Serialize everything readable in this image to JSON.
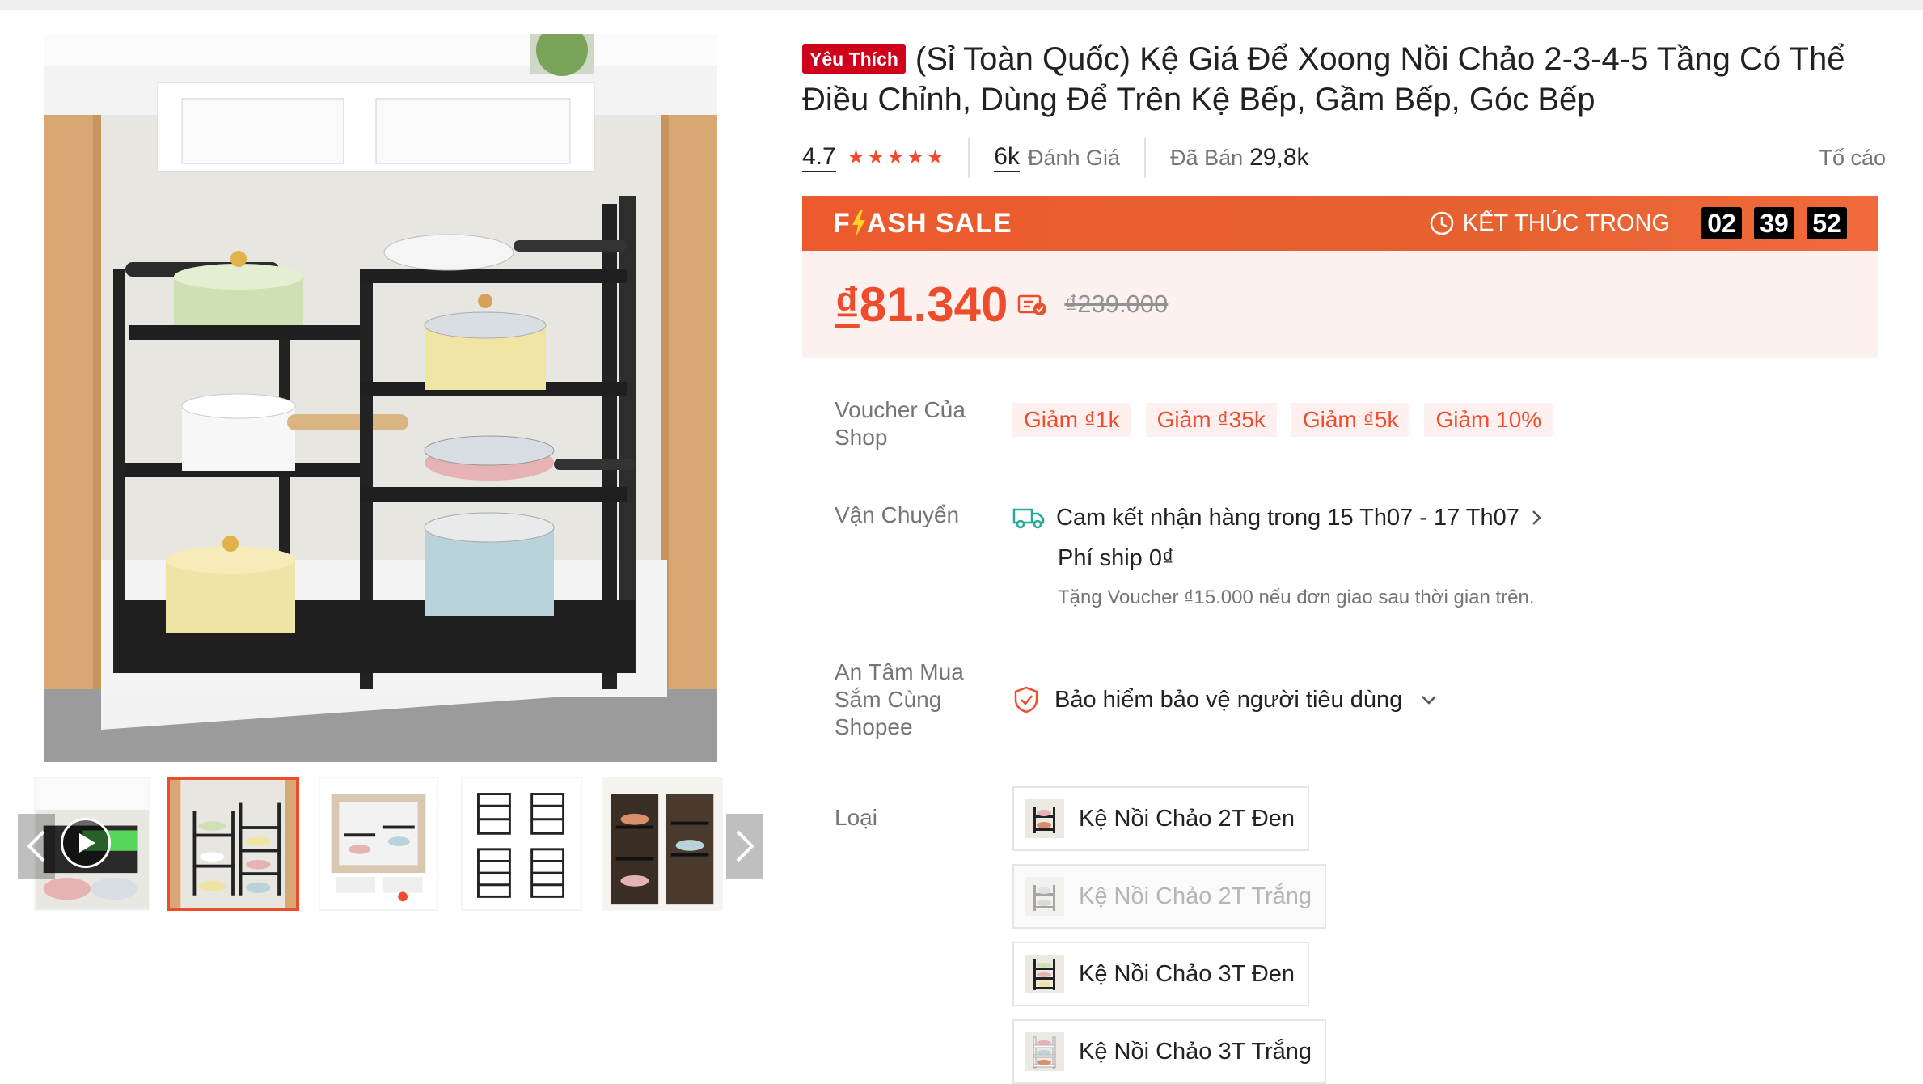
{
  "gallery": {
    "thumbnails": [
      {
        "name": "video-thumbnail",
        "has_video": true
      },
      {
        "name": "thumbnail-2",
        "active": true
      },
      {
        "name": "thumbnail-3"
      },
      {
        "name": "thumbnail-4"
      },
      {
        "name": "thumbnail-5"
      }
    ]
  },
  "product": {
    "favorite_badge": "Yêu Thích",
    "title": "(Sỉ Toàn Quốc) Kệ Giá Để Xoong Nồi Chảo 2-3-4-5 Tầng Có Thể Điều Chỉnh, Dùng Để Trên Kệ Bếp, Gầm Bếp, Góc Bếp"
  },
  "stats": {
    "rating": "4.7",
    "stars": 5,
    "reviews_count": "6k",
    "reviews_label": "Đánh Giá",
    "sold_label": "Đã Bán",
    "sold_count": "29,8k",
    "report_label": "Tố cáo"
  },
  "flash_sale": {
    "logo_pre": "F",
    "logo_post": "ASH SALE",
    "ends_label": "KẾT THÚC TRONG",
    "hours": "02",
    "minutes": "39",
    "seconds": "52"
  },
  "price": {
    "currency": "₫",
    "current": "81.340",
    "original": "₫239.000"
  },
  "shop_voucher": {
    "label": "Voucher Của Shop",
    "chips": [
      "Giảm ₫1k",
      "Giảm ₫35k",
      "Giảm ₫5k",
      "Giảm 10%"
    ]
  },
  "shipping": {
    "label": "Vận Chuyển",
    "delivery": "Cam kết nhận hàng trong 15 Th07 - 17 Th07",
    "fee": "Phí ship 0₫",
    "note": "Tặng Voucher ₫15.000 nếu đơn giao sau thời gian trên."
  },
  "assurance": {
    "label": "An Tâm Mua Sắm Cùng Shopee",
    "text": "Bảo hiểm bảo vệ người tiêu dùng"
  },
  "variants": {
    "label": "Loại",
    "options": [
      {
        "label": "Kệ Nồi Chảo 2T Đen",
        "disabled": false
      },
      {
        "label": "Kệ Nồi Chảo 2T Trắng",
        "disabled": true
      },
      {
        "label": "Kệ Nồi Chảo 3T Đen",
        "disabled": false
      },
      {
        "label": "Kệ Nồi Chảo 3T Trắng",
        "disabled": false
      }
    ]
  },
  "colors": {
    "accent": "#ee4d2d",
    "badge": "#d0011b",
    "price_bg": "#fdf1ef"
  }
}
